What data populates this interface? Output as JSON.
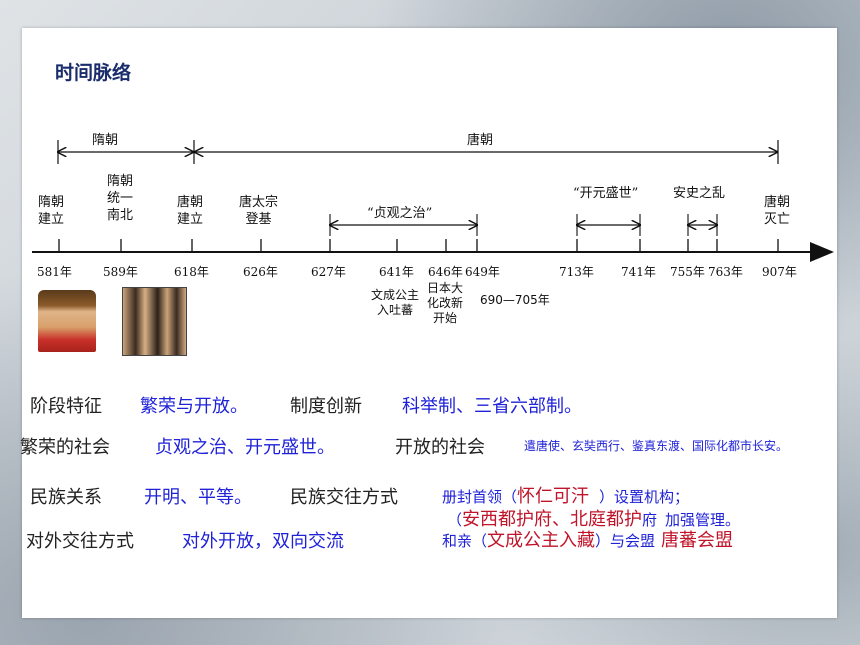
{
  "slide": {
    "title": "时间脉络"
  },
  "timeline": {
    "period_sui": "隋朝",
    "period_tang": "唐朝",
    "events": {
      "sui_founded": [
        "隋朝",
        "建立"
      ],
      "sui_unify": [
        "隋朝",
        "统一",
        "南北"
      ],
      "tang_founded": [
        "唐朝",
        "建立"
      ],
      "taizong": [
        "唐太宗",
        "登基"
      ],
      "tang_fall": [
        "唐朝",
        "灭亡"
      ]
    },
    "eras": {
      "zhenguan": "“贞观之治”",
      "kaiyuan": "“开元盛世”",
      "anshi": "安史之乱"
    },
    "years": [
      "581年",
      "589年",
      "618年",
      "626年",
      "627年",
      "641年",
      "646年",
      "649年",
      "713年",
      "741年",
      "755年",
      "763年",
      "907年"
    ],
    "notes": {
      "wencheng": [
        "文成公主",
        "入吐蕃"
      ],
      "taika": [
        "日本大",
        "化改新",
        "开始"
      ],
      "wuzetian": "690—705年"
    }
  },
  "summary": {
    "row1": {
      "label_a": "阶段特征",
      "value_a": "繁荣与开放。",
      "label_b": "制度创新",
      "value_b": "科举制、三省六部制。"
    },
    "row2": {
      "label_a": "繁荣的社会",
      "value_a": "贞观之治、开元盛世。",
      "label_b": "开放的社会",
      "value_b": "遣唐使、玄奘西行、鉴真东渡、国际化都市长安。"
    },
    "row3": {
      "label_a": "民族关系",
      "value_a": "开明、平等。",
      "label_b": "民族交往方式",
      "line1_prefix": "册封首领（",
      "line1_red": "怀仁可汗",
      "line1_suffix": "）设置机构；",
      "line2_prefix": "（",
      "line2_red": "安西都护府、北庭都护",
      "line2_mid": "府",
      "line2_suffix": "加强管理。",
      "line3_prefix": "和亲（",
      "line3_red": "文成公主入藏",
      "line3_mid": "）与会盟",
      "line3_red2": "唐蕃会盟"
    },
    "row4": {
      "label_a": "对外交往方式",
      "value_a": "对外开放，双向交流"
    }
  }
}
